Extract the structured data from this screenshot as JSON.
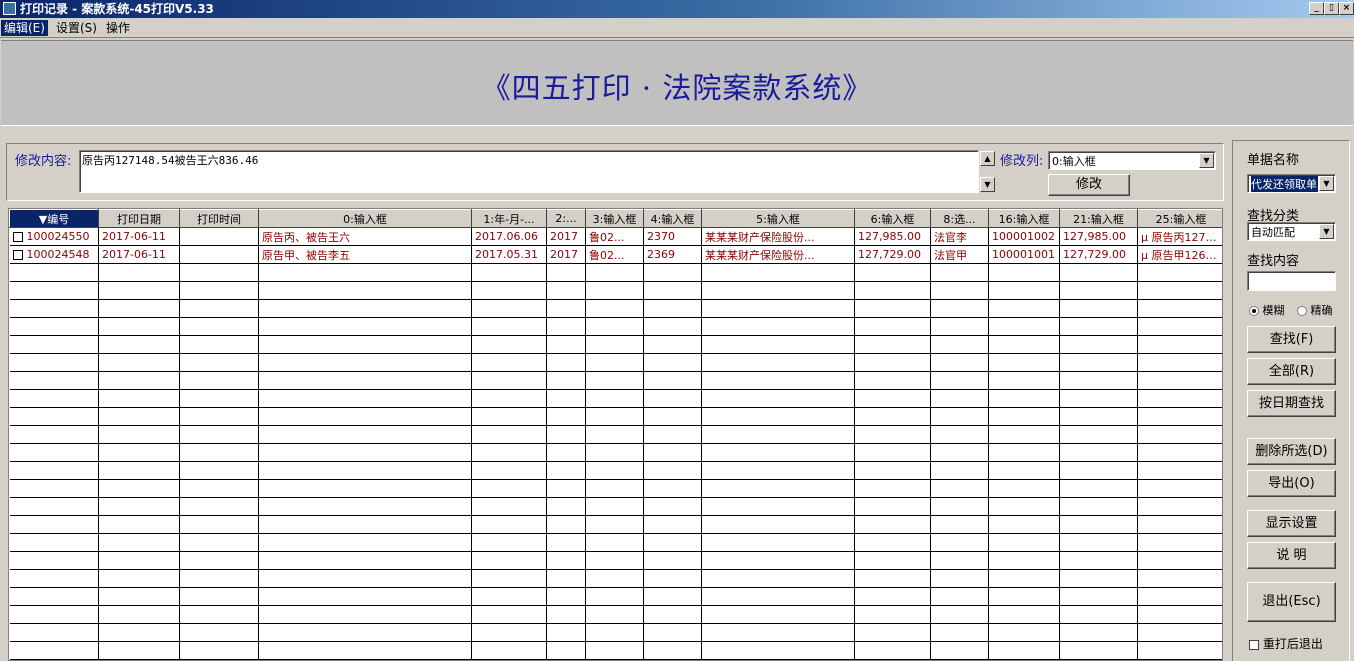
{
  "window": {
    "title": "打印记录 - 案款系统-45打印V5.33",
    "controls": [
      "_",
      "▯",
      "×"
    ]
  },
  "menu": [
    "编辑(E)",
    "设置(S)",
    "操作"
  ],
  "banner": {
    "title": "《四五打印 · 法院案款系统》"
  },
  "edit": {
    "content_label": "修改内容:",
    "content_value": "原告丙127148.54被告王六836.46",
    "column_label": "修改列:",
    "column_value": "0:输入框",
    "modify_button": "修改"
  },
  "table": {
    "columns": [
      "▼编号",
      "打印日期",
      "打印时间",
      "0:输入框",
      "1:年-月-...",
      "2:...",
      "3:输入框",
      "4:输入框",
      "5:输入框",
      "6:输入框",
      "8:选...",
      "16:输入框",
      "21:输入框",
      "25:输入框"
    ],
    "rows": [
      [
        "100024550",
        "2017-06-11",
        "",
        "原告丙、被告王六",
        "2017.06.06",
        "2017",
        "鲁02...",
        "2370",
        "某某某财产保险股份...",
        "127,985.00",
        "法官李",
        "100001002",
        "127,985.00",
        "μ 原告丙12714..."
      ],
      [
        "100024548",
        "2017-06-11",
        "",
        "原告甲、被告李五",
        "2017.05.31",
        "2017",
        "鲁02...",
        "2369",
        "某某某财产保险股份...",
        "127,729.00",
        "法官甲",
        "100001001",
        "127,729.00",
        "μ 原告甲12689..."
      ]
    ]
  },
  "side": {
    "doc_name_label": "单据名称",
    "doc_name_value": "代发还领取单",
    "category_label": "查找分类",
    "category_value": "自动匹配",
    "search_label": "查找内容",
    "search_value": "",
    "radio_fuzzy": "模糊",
    "radio_exact": "精确",
    "btn_find": "查找(F)",
    "btn_all": "全部(R)",
    "btn_date": "按日期查找",
    "btn_delete": "删除所选(D)",
    "btn_export": "导出(O)",
    "btn_display": "显示设置",
    "btn_help": "说 明",
    "btn_exit": "退出(Esc)",
    "reprint_exit": "重打后退出"
  }
}
